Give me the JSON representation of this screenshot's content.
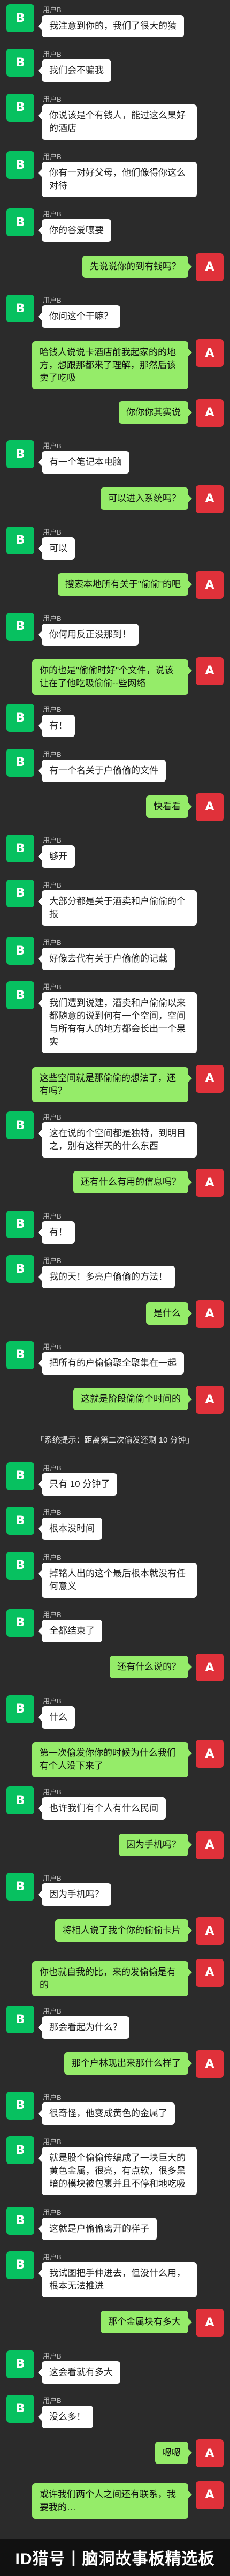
{
  "participants": {
    "left_avatar": "B",
    "right_avatar": "A"
  },
  "messages": [
    {
      "side": "left",
      "name": "用户B",
      "text": "我注意到你的，我们了很大的猿"
    },
    {
      "side": "left",
      "name": "用户B",
      "text": "我们会不骗我"
    },
    {
      "side": "left",
      "name": "用户B",
      "text": "你说该是个有钱人，能过这么果好的酒店"
    },
    {
      "side": "left",
      "name": "用户B",
      "text": "你有一对好父母，他们像得你这么对待"
    },
    {
      "side": "left",
      "name": "用户B",
      "text": "你的谷爱嚷要"
    },
    {
      "side": "right",
      "text": "先说说你的到有钱吗？"
    },
    {
      "side": "left",
      "name": "用户B",
      "text": "你问这个干嘛？"
    },
    {
      "side": "right",
      "text": "哈钱人说说卡酒店前我起家的的地方，想跟那都来了理解，那然后该卖了吃吸"
    },
    {
      "side": "right",
      "text": "你你你其实说"
    },
    {
      "side": "left",
      "name": "用户B",
      "text": "有一个笔记本电脑"
    },
    {
      "side": "right",
      "text": "可以进入系统吗？"
    },
    {
      "side": "left",
      "name": "用户B",
      "text": "可以"
    },
    {
      "side": "right",
      "text": "搜索本地所有关于\"偷偷\"的吧"
    },
    {
      "side": "left",
      "name": "用户B",
      "text": "你何用反正没那到！"
    },
    {
      "side": "right",
      "text": "你的也是\"偷偷时好\"个文件，说该让在了他吃吸偷偷--些网络"
    },
    {
      "side": "left",
      "name": "用户B",
      "text": "有！"
    },
    {
      "side": "left",
      "name": "用户B",
      "text": "有一个名关于户偷偷的文件"
    },
    {
      "side": "right",
      "text": "快看看"
    },
    {
      "side": "left",
      "name": "用户B",
      "text": "够开"
    },
    {
      "side": "left",
      "name": "用户B",
      "text": "大部分都是关于酒卖和户偷偷的个报"
    },
    {
      "side": "left",
      "name": "用户B",
      "text": "好像去代有关于户偷偷的记载"
    },
    {
      "side": "left",
      "name": "用户B",
      "text": "我们遭到说建，酒卖和户偷偷以来都随意的说到何有一个空间，空间与所有有人的地方都会长出一个果实"
    },
    {
      "side": "right",
      "text": "这些空间就是那偷偷的想法了，还有吗？"
    },
    {
      "side": "left",
      "name": "用户B",
      "text": "这在说的个空间都是独特，到明目之，别有这样天的什么东西"
    },
    {
      "side": "right",
      "text": "还有什么有用的信息吗？"
    },
    {
      "side": "left",
      "name": "用户B",
      "text": "有！"
    },
    {
      "side": "left",
      "name": "用户B",
      "text": "我的天！多亮户偷偷的方法！"
    },
    {
      "side": "right",
      "text": "是什么"
    },
    {
      "side": "left",
      "name": "用户B",
      "text": "把所有的户偷偷聚全聚集在一起"
    },
    {
      "side": "right",
      "text": "这就是阶段偷偷个时间的"
    },
    {
      "type": "system",
      "text": "「系统提示：距离第二次偷发还剩 10 分钟」"
    },
    {
      "side": "left",
      "name": "用户B",
      "text": "只有 10 分钟了"
    },
    {
      "side": "left",
      "name": "用户B",
      "text": "根本没时间"
    },
    {
      "side": "left",
      "name": "用户B",
      "text": "掉铭人出的这个最后根本就没有任何意义"
    },
    {
      "side": "left",
      "name": "用户B",
      "text": "全都结束了"
    },
    {
      "side": "right",
      "text": "还有什么说的？"
    },
    {
      "side": "left",
      "name": "用户B",
      "text": "什么"
    },
    {
      "side": "right",
      "text": "第一次偷发你你的时候为什么我们有个人没下来了"
    },
    {
      "side": "left",
      "name": "用户B",
      "text": "也许我们有个人有什么民间"
    },
    {
      "side": "right",
      "text": "因为手机吗？"
    },
    {
      "side": "left",
      "name": "用户B",
      "text": "因为手机吗？"
    },
    {
      "side": "right",
      "text": "将相人说了我个你的偷偷卡片"
    },
    {
      "side": "right",
      "text": "你也就自我的比，来的发偷偷是有的"
    },
    {
      "side": "left",
      "name": "用户B",
      "text": "那会看起为什么？"
    },
    {
      "side": "right",
      "text": "那个户林现出来那什么样了"
    },
    {
      "side": "left",
      "name": "用户B",
      "text": "很奇怪，他变成黄色的金属了"
    },
    {
      "side": "left",
      "name": "用户B",
      "text": "就是股个偷偷传编成了一块巨大的黄色金属，很亮，有点软，很多黑暗的模块被包裹并且不停和地吃吸"
    },
    {
      "side": "left",
      "name": "用户B",
      "text": "这就是户偷偷离开的样子"
    },
    {
      "side": "left",
      "name": "用户B",
      "text": "我试图把手伸进去，但没什么用，根本无法推进"
    },
    {
      "side": "right",
      "text": "那个金属块有多大"
    },
    {
      "side": "left",
      "name": "用户B",
      "text": "这会看就有多大"
    },
    {
      "side": "left",
      "name": "用户B",
      "text": "没么多！"
    },
    {
      "side": "right",
      "text": "嗯嗯"
    },
    {
      "side": "right",
      "text": "或许我们两个人之间还有联系，我要我的…"
    }
  ],
  "footer": {
    "text": "ID猎号丨脑洞故事板精选板"
  }
}
